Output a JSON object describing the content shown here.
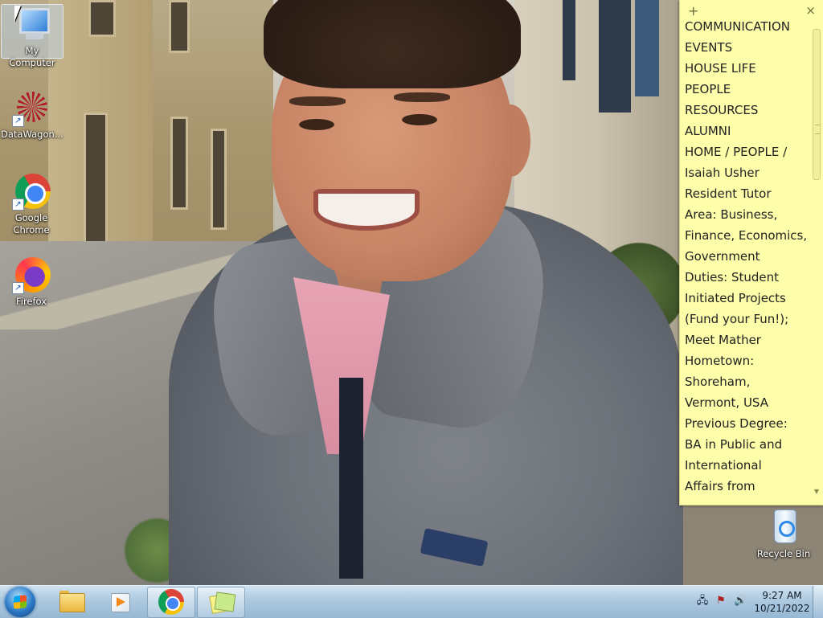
{
  "desktop": {
    "icons": [
      {
        "label": "My Computer",
        "icon": "computer-icon",
        "selected": true
      },
      {
        "label": "DataWagon...",
        "icon": "datawagon-icon"
      },
      {
        "label": "Google Chrome",
        "icon": "chrome-icon"
      },
      {
        "label": "Firefox",
        "icon": "firefox-icon"
      },
      {
        "label": "Recycle Bin",
        "icon": "recycle-bin-icon"
      }
    ]
  },
  "sticky_note": {
    "add_glyph": "+",
    "close_glyph": "×",
    "lines": [
      "COMMUNICATION",
      "EVENTS",
      "HOUSE LIFE",
      "PEOPLE",
      "RESOURCES",
      "ALUMNI",
      "HOME / PEOPLE /",
      "Isaiah Usher",
      "Resident Tutor",
      "Area: Business,",
      "Finance, Economics,",
      "Government",
      "Duties: Student",
      "Initiated Projects",
      "(Fund your Fun!);",
      "Meet Mather",
      "Hometown:",
      "Shoreham,",
      "Vermont, USA",
      "Previous Degree:",
      "BA in Public and",
      "International",
      "Affairs from"
    ],
    "color": "#fdfdaa"
  },
  "taskbar": {
    "pinned": [
      {
        "name": "windows-explorer",
        "icon": "folder-icon",
        "active": false
      },
      {
        "name": "media-player",
        "icon": "media-player-icon",
        "active": false
      },
      {
        "name": "google-chrome",
        "icon": "chrome-icon",
        "active": true
      },
      {
        "name": "sticky-notes",
        "icon": "sticky-notes-icon",
        "active": true
      }
    ],
    "tray": {
      "network_icon": "network-icon",
      "action_center_icon": "action-center-flag-icon",
      "volume_icon": "volume-icon",
      "time": "9:27 AM",
      "date": "10/21/2022"
    }
  }
}
